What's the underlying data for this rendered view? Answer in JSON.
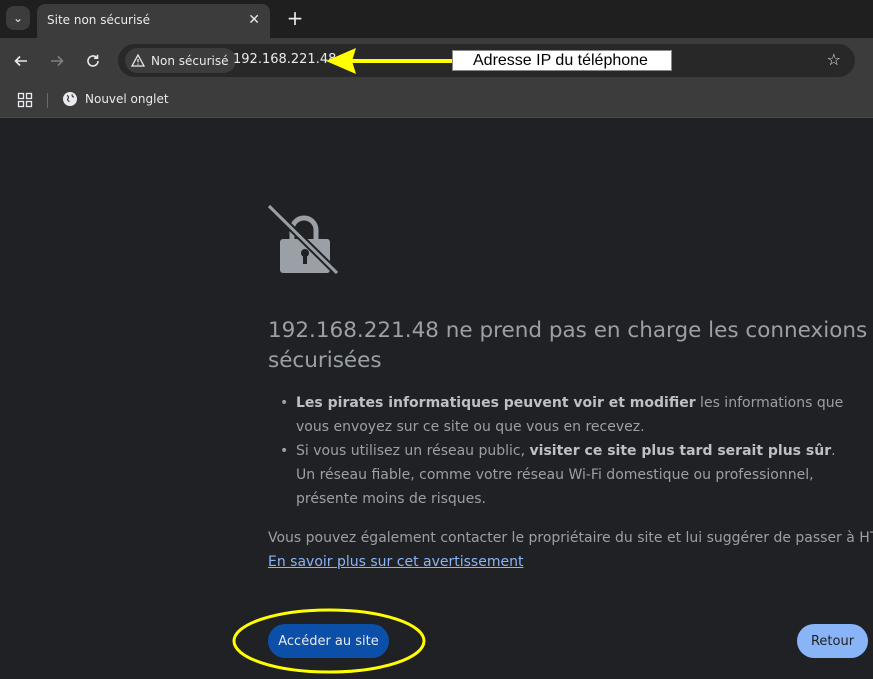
{
  "tab": {
    "title": "Site non sécurisé",
    "close_glyph": "✕",
    "new_tab_glyph": "+",
    "search_glyph": "⌄"
  },
  "toolbar": {
    "security_chip": "Non sécurisé",
    "url": "192.168.221.48"
  },
  "bookmarks": {
    "items": [
      {
        "label": "Nouvel onglet",
        "icon": "globe-icon"
      }
    ]
  },
  "annotation": {
    "label": "Adresse IP du téléphone",
    "color": "#ffff00"
  },
  "page": {
    "headline": "192.168.221.48 ne prend pas en charge les connexions sécurisées",
    "bullet1_bold": "Les pirates informatiques peuvent voir et modifier",
    "bullet1_rest": " les informations que vous envoyez sur ce site ou que vous en recevez.",
    "bullet2_pre": "Si vous utilisez un réseau public, ",
    "bullet2_bold": "visiter ce site plus tard serait plus sûr",
    "bullet2_rest": ". Un réseau fiable, comme votre réseau Wi-Fi domestique ou professionnel, présente moins de risques.",
    "paragraph": "Vous pouvez également contacter le propriétaire du site et lui suggérer de passer à HTTPS.",
    "learn_more": "En savoir plus sur cet avertissement",
    "primary_button": "Accéder au site",
    "secondary_button": "Retour"
  },
  "colors": {
    "background": "#202124",
    "toolbar": "#3c3c3c",
    "link": "#8ab4f8",
    "primary_button": "#0b4fa8",
    "annotation": "#ffff00"
  }
}
